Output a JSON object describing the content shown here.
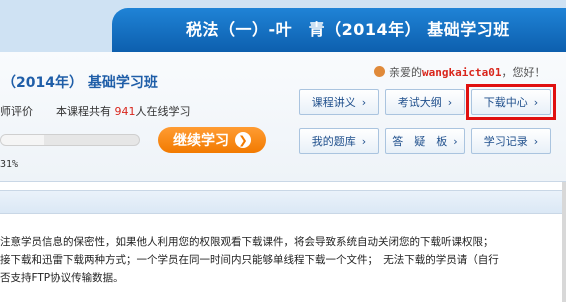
{
  "header": {
    "title": "税法（一）-叶　青（2014年） 基础学习班"
  },
  "course": {
    "title": "（2014年） 基础学习班",
    "rating_label": "师评价",
    "online_prefix": "本课程共有",
    "online_count": "941",
    "online_suffix": "人在线学习",
    "progress_text": "31%",
    "progress_fraction": 0.31,
    "continue_label": "继续学习"
  },
  "user": {
    "greeting_prefix": "亲爱的",
    "username": "wangkaicta01",
    "greeting_suffix": "，您好！"
  },
  "nav": {
    "lectures": "课程讲义",
    "syllabus": "考试大纲",
    "downloads": "下载中心",
    "question_bank": "我的题库",
    "qa_board": "答　疑　板",
    "study_record": "学习记录"
  },
  "notice": {
    "line1": "注意学员信息的保密性，如果他人利用您的权限观看下载课件，将会导致系统自动关闭您的下载听课权限；",
    "line2": "接下载和迅雷下载两种方式；一个学员在同一时间内只能够单线程下载一个文件；　无法下载的学员请（自行",
    "line3": "否支持FTP协议传输数据。"
  },
  "colors": {
    "brand_blue": "#1f83d6",
    "accent_orange": "#f27a00",
    "highlight_red": "#e01010",
    "count_red": "#d9261c"
  }
}
